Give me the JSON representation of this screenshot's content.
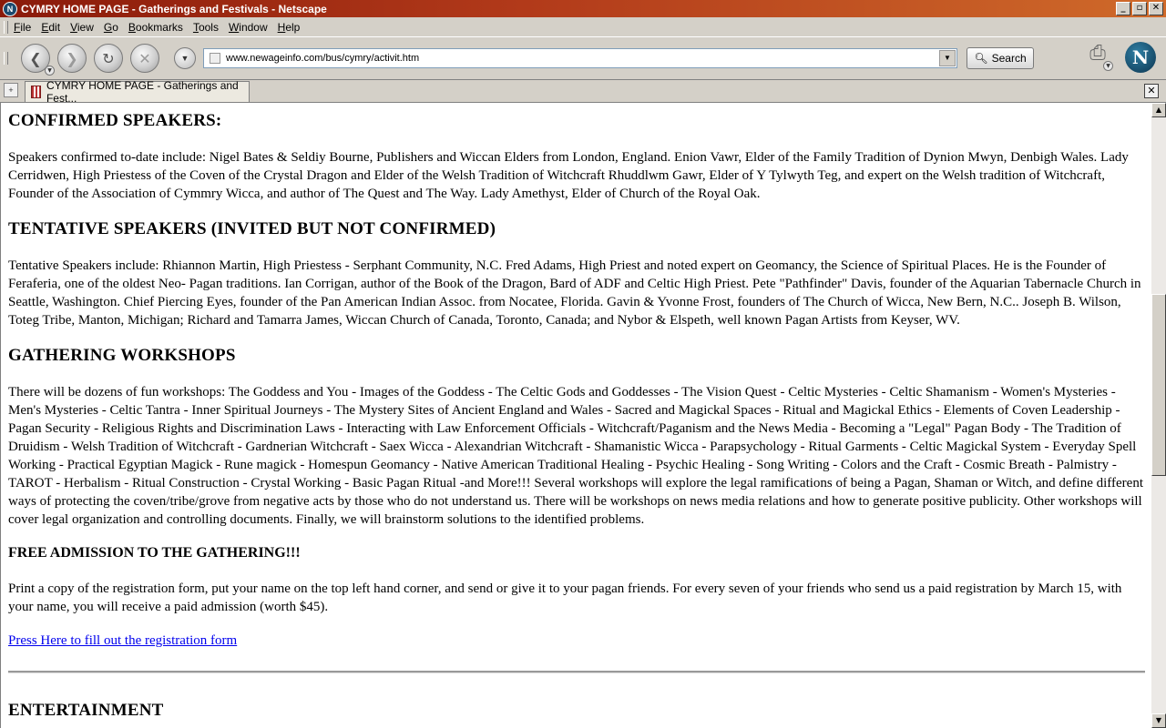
{
  "window": {
    "title": "CYMRY HOME PAGE - Gatherings and Festivals - Netscape",
    "app_icon": "N",
    "buttons": [
      "_",
      "▫",
      "✕"
    ]
  },
  "menu": {
    "items": [
      {
        "mn": "F",
        "rest": "ile"
      },
      {
        "mn": "E",
        "rest": "dit"
      },
      {
        "mn": "V",
        "rest": "iew"
      },
      {
        "mn": "G",
        "rest": "o"
      },
      {
        "mn": "B",
        "rest": "ookmarks"
      },
      {
        "mn": "T",
        "rest": "ools"
      },
      {
        "mn": "W",
        "rest": "indow"
      },
      {
        "mn": "H",
        "rest": "elp"
      }
    ]
  },
  "toolbar": {
    "url": "www.newageinfo.com/bus/cymry/activit.htm",
    "search_label": "Search",
    "logo_letter": "N"
  },
  "tab": {
    "label": "CYMRY HOME PAGE - Gatherings and Fest..."
  },
  "page": {
    "confirmed_heading": "CONFIRMED SPEAKERS:",
    "confirmed_text": "Speakers confirmed to-date include: Nigel Bates & Seldiy Bourne, Publishers and Wiccan Elders from London, England. Enion Vawr, Elder of the Family Tradition of Dynion Mwyn, Denbigh Wales. Lady Cerridwen, High Priestess of the Coven of the Crystal Dragon and Elder of the Welsh Tradition of Witchcraft Rhuddlwm Gawr, Elder of Y Tylwyth Teg, and expert on the Welsh tradition of Witchcraft, Founder of the Association of Cymmry Wicca, and author of The Quest and The Way. Lady Amethyst, Elder of Church of the Royal Oak.",
    "tentative_heading": "TENTATIVE SPEAKERS (INVITED BUT NOT CONFIRMED)",
    "tentative_text": "Tentative Speakers include: Rhiannon Martin, High Priestess - Serphant Community, N.C. Fred Adams, High Priest and noted expert on Geomancy, the Science of Spiritual Places. He is the Founder of Feraferia, one of the oldest Neo- Pagan traditions. Ian Corrigan, author of the Book of the Dragon, Bard of ADF and Celtic High Priest. Pete \"Pathfinder\" Davis, founder of the Aquarian Tabernacle Church in Seattle, Washington. Chief Piercing Eyes, founder of the Pan American Indian Assoc. from Nocatee, Florida. Gavin & Yvonne Frost, founders of The Church of Wicca, New Bern, N.C.. Joseph B. Wilson, Toteg Tribe, Manton, Michigan; Richard and Tamarra James, Wiccan Church of Canada, Toronto, Canada; and Nybor & Elspeth, well known Pagan Artists from Keyser, WV.",
    "workshops_heading": "GATHERING WORKSHOPS",
    "workshops_text": "There will be dozens of fun workshops: The Goddess and You - Images of the Goddess - The Celtic Gods and Goddesses - The Vision Quest - Celtic Mysteries - Celtic Shamanism - Women's Mysteries - Men's Mysteries - Celtic Tantra - Inner Spiritual Journeys - The Mystery Sites of Ancient England and Wales - Sacred and Magickal Spaces - Ritual and Magickal Ethics - Elements of Coven Leadership - Pagan Security - Religious Rights and Discrimination Laws - Interacting with Law Enforcement Officials - Witchcraft/Paganism and the News Media - Becoming a \"Legal\" Pagan Body - The Tradition of Druidism - Welsh Tradition of Witchcraft - Gardnerian Witchcraft - Saex Wicca - Alexandrian Witchcraft - Shamanistic Wicca - Parapsychology - Ritual Garments - Celtic Magickal System - Everyday Spell Working - Practical Egyptian Magick - Rune magick - Homespun Geomancy - Native American Traditional Healing - Psychic Healing - Song Writing - Colors and the Craft - Cosmic Breath - Palmistry - TAROT - Herbalism - Ritual Construction - Crystal Working - Basic Pagan Ritual -and More!!! Several workshops will explore the legal ramifications of being a Pagan, Shaman or Witch, and define different ways of protecting the coven/tribe/grove from negative acts by those who do not understand us. There will be workshops on news media relations and how to generate positive publicity. Other workshops will cover legal organization and controlling documents. Finally, we will brainstorm solutions to the identified problems.",
    "free_heading": "FREE ADMISSION TO THE GATHERING!!!",
    "free_text": "Print a copy of the registration form, put your name on the top left hand corner, and send or give it to your pagan friends. For every seven of your friends who send us a paid registration by March 15, with your name, you will receive a paid admission (worth $45).",
    "registration_link": "Press Here to fill out the registration form",
    "entertainment_heading": "ENTERTAINMENT"
  },
  "colors": {
    "link": "#0000ee",
    "titlebar": "#8a1a0a",
    "chrome": "#d4d0c8"
  }
}
